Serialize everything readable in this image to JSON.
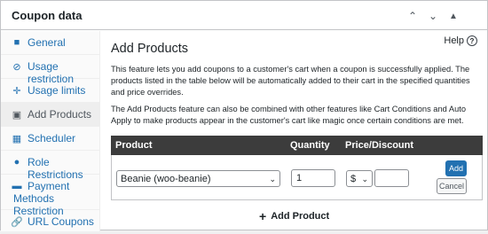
{
  "panel": {
    "title": "Coupon data"
  },
  "header_icons": {
    "up": "chevron-up-icon",
    "down": "chevron-down-icon",
    "toggle": "caret-up-icon"
  },
  "sidebar": {
    "items": [
      {
        "label": "General",
        "icon": "ticket-icon",
        "glyph": "▀"
      },
      {
        "label": "Usage restriction",
        "icon": "block-icon",
        "glyph": "⊘"
      },
      {
        "label": "Usage limits",
        "icon": "plus-move-icon",
        "glyph": "✛"
      },
      {
        "label": "Add Products",
        "icon": "briefcase-icon",
        "glyph": "■"
      },
      {
        "label": "Scheduler",
        "icon": "calendar-icon",
        "glyph": "▦"
      },
      {
        "label": "Role Restrictions",
        "icon": "user-icon",
        "glyph": "●"
      },
      {
        "label": "Payment Methods Restriction",
        "icon": "card-icon",
        "glyph": "▬"
      },
      {
        "label": "URL Coupons",
        "icon": "link-icon",
        "glyph": "⛓"
      }
    ],
    "active": "Add Products"
  },
  "main": {
    "help_label": "Help",
    "title": "Add Products",
    "desc1": "This feature lets you add coupons to a customer's cart when a coupon is successfully applied. The products listed in the table below will be automatically added to their cart in the specified quantities and price overrides.",
    "desc2": "The Add Products feature can also be combined with other features like Cart Conditions and Auto Apply to make products appear in the customer's cart like magic once certain conditions are met.",
    "table": {
      "headers": {
        "product": "Product",
        "quantity": "Quantity",
        "price": "Price/Discount"
      },
      "row": {
        "product_value": "Beanie (woo-beanie)",
        "quantity_value": "1",
        "currency_value": "$",
        "price_value": ""
      }
    },
    "add_button": "Add",
    "cancel_button": "Cancel",
    "add_product_link": "Add Product"
  },
  "colors": {
    "accent": "#2271b1",
    "table_header": "#3c3c3c",
    "active_tab": "#eeeeee"
  }
}
